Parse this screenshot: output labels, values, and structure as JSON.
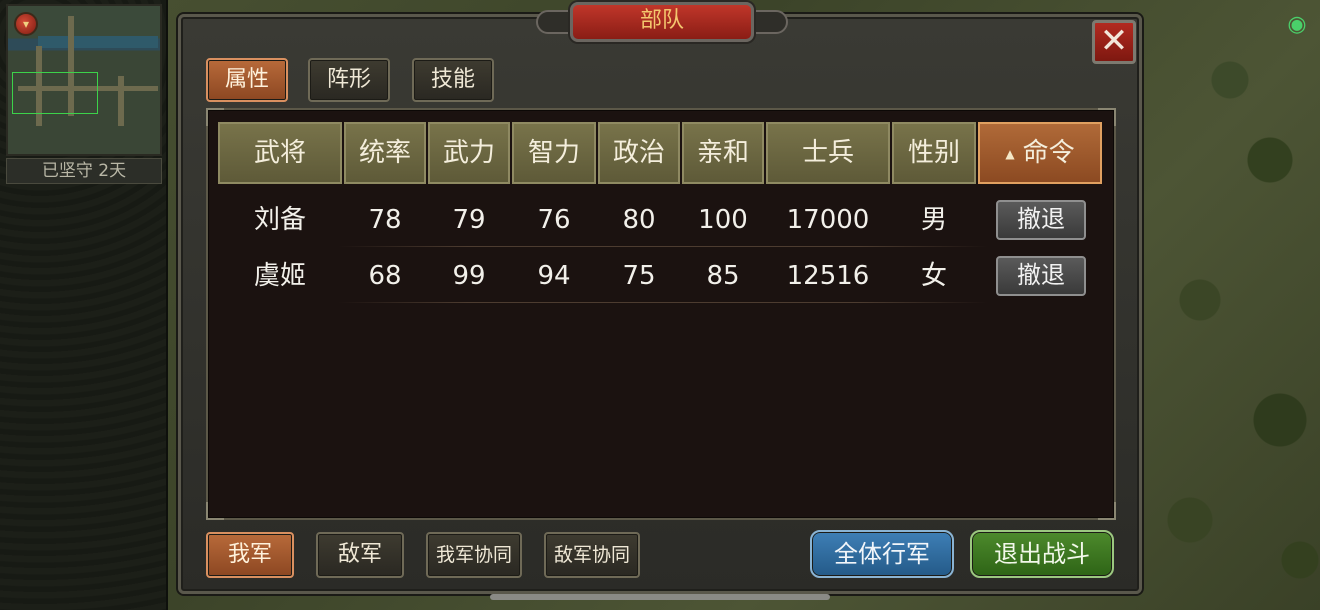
{
  "panel": {
    "title": "部队",
    "close_label": "✕"
  },
  "status": {
    "defense_text": "已坚守  2天"
  },
  "top_tabs": [
    {
      "label": "属性",
      "active": true
    },
    {
      "label": "阵形",
      "active": false
    },
    {
      "label": "技能",
      "active": false
    }
  ],
  "table": {
    "headers": [
      "武将",
      "统率",
      "武力",
      "智力",
      "政治",
      "亲和",
      "士兵",
      "性别",
      "命令"
    ],
    "sort_indicator": "▲",
    "rows": [
      {
        "name": "刘备",
        "leadership": "78",
        "force": "79",
        "intellect": "76",
        "politics": "80",
        "charm": "100",
        "soldiers": "17000",
        "gender": "男",
        "command": "撤退"
      },
      {
        "name": "虞姬",
        "leadership": "68",
        "force": "99",
        "intellect": "94",
        "politics": "75",
        "charm": "85",
        "soldiers": "12516",
        "gender": "女",
        "command": "撤退"
      }
    ]
  },
  "bottom_tabs": [
    {
      "label": "我军",
      "active": true
    },
    {
      "label": "敌军",
      "active": false
    },
    {
      "label": "我军协同",
      "active": false
    },
    {
      "label": "敌军协同",
      "active": false
    }
  ],
  "actions": {
    "march_all": "全体行军",
    "exit_battle": "退出战斗"
  },
  "colors": {
    "accent_active": "#b86a3a",
    "title_red": "#c0362a",
    "march_blue": "#3e7fb6",
    "exit_green": "#4d8a2c"
  }
}
